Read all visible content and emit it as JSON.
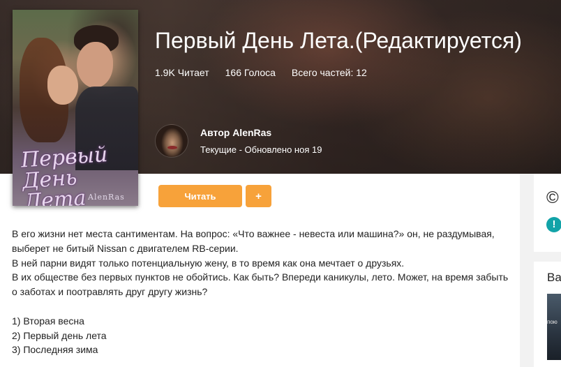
{
  "story": {
    "title": "Первый День Лета.(Редактируется)",
    "stats": {
      "reads": "1.9K Читает",
      "votes": "166 Голоса",
      "parts": "Всего частей: 12"
    },
    "cover_title": "Первый День Лета",
    "cover_author": "AlenRas"
  },
  "author": {
    "label": "Автор AlenRas",
    "status": "Текущие - Обновлено ноя 19"
  },
  "actions": {
    "read_label": "Читать",
    "add_label": "+"
  },
  "description": [
    "В его жизни нет места сантиментам. На вопрос: «Что важнее - невеста или машина?» он, не раздумывая, выберет не битый Nissan с двигателем RB-серии.",
    "В ней парни видят только потенциальную жену, в то время как она мечтает о друзьях.",
    "В их обществе без первых пунктов не обойтись. Как быть? Впереди каникулы, лето. Может, на время забыть о заботах и поотравлять друг другу жизнь?",
    "",
    "1) Вторая весна",
    "2) Первый день лета",
    "3) Последняя зима"
  ],
  "sidebar": {
    "copyright_symbol": "©",
    "alert_symbol": "!",
    "heading": "Ва",
    "thumb_text": "пою"
  },
  "colors": {
    "accent": "#f7a23a",
    "teal": "#12a3a8",
    "text": "#222222"
  },
  "icons": [
    "copyright-icon",
    "alert-icon"
  ]
}
